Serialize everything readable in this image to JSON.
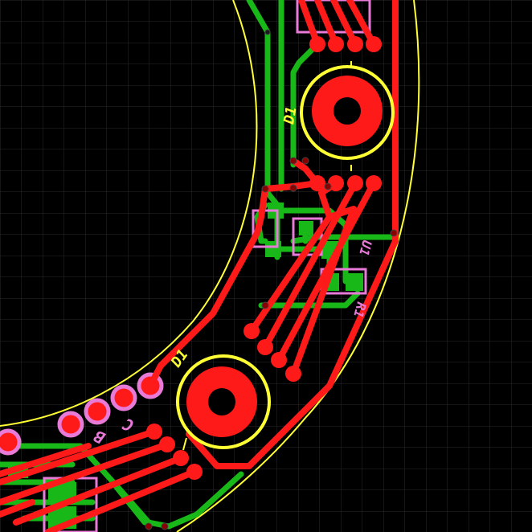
{
  "colors": {
    "background": "#000000",
    "grid": "#2a2a2a",
    "top_copper": "#ff1a1a",
    "bottom_copper": "#19b819",
    "silkscreen": "#ffff33",
    "outline": "#ffff33",
    "pad_outline": "#e87ad8"
  },
  "labels": {
    "led_upper": "D1",
    "led_lower": "D1",
    "ic": "U1",
    "resistor": "R1",
    "pin_b": "B",
    "pin_c": "C"
  }
}
